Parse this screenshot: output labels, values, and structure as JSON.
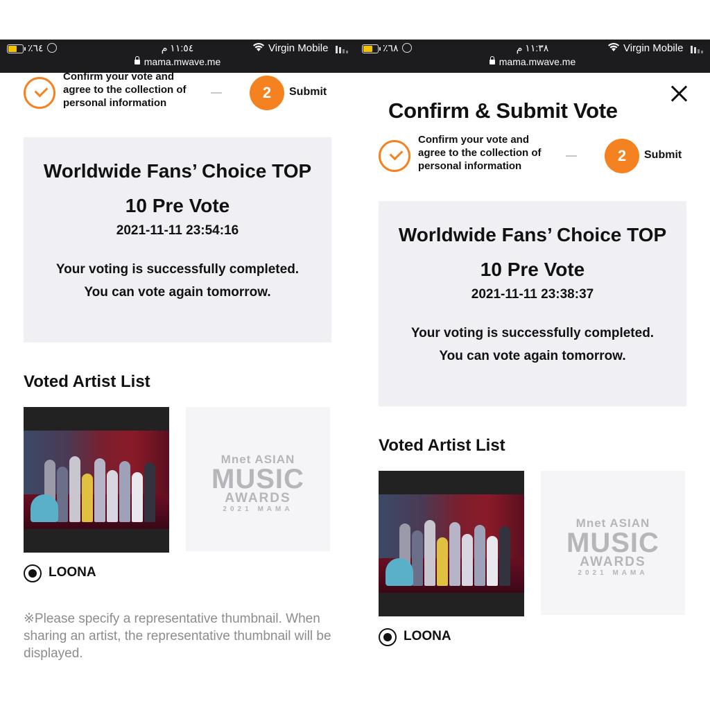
{
  "left": {
    "status": {
      "battery_pct": "٪٦٤",
      "time": "١١:٥٤ م",
      "carrier": "Virgin Mobile",
      "url": "mama.mwave.me"
    },
    "steps": {
      "step1_label": "Confirm your vote and agree to the collection of personal information",
      "step2_number": "2",
      "step2_label": "Submit"
    },
    "result": {
      "title": "Worldwide Fans’ Choice TOP 10 Pre Vote",
      "datetime": "2021-11-11 23:54:16",
      "message": "Your voting is successfully completed. You can vote again tomorrow."
    },
    "voted_list_title": "Voted Artist List",
    "artist": {
      "name": "LOONA"
    },
    "note": "※Please specify a representative thumbnail. When sharing an artist, the representative thumbnail will be displayed."
  },
  "right": {
    "status": {
      "battery_pct": "٪٦٨",
      "time": "١١:٣٨ م",
      "carrier": "Virgin Mobile",
      "url": "mama.mwave.me"
    },
    "modal_title": "Confirm & Submit Vote",
    "steps": {
      "step1_label": "Confirm your vote and agree to the collection of personal information",
      "step2_number": "2",
      "step2_label": "Submit"
    },
    "result": {
      "title": "Worldwide Fans’ Choice TOP 10 Pre Vote",
      "datetime": "2021-11-11 23:38:37",
      "message": "Your voting is successfully completed. You can vote again tomorrow."
    },
    "voted_list_title": "Voted Artist List",
    "artist": {
      "name": "LOONA"
    }
  },
  "logo": {
    "line1": "Mnet ASIAN",
    "line2": "MUSIC",
    "line3": "AWARDS",
    "line4": "2021 MAMA"
  },
  "colors": {
    "accent": "#f58220",
    "box_bg": "#f0eff4",
    "statusbar_bg": "#1c1c1e",
    "note_text": "#8c8c8c"
  }
}
